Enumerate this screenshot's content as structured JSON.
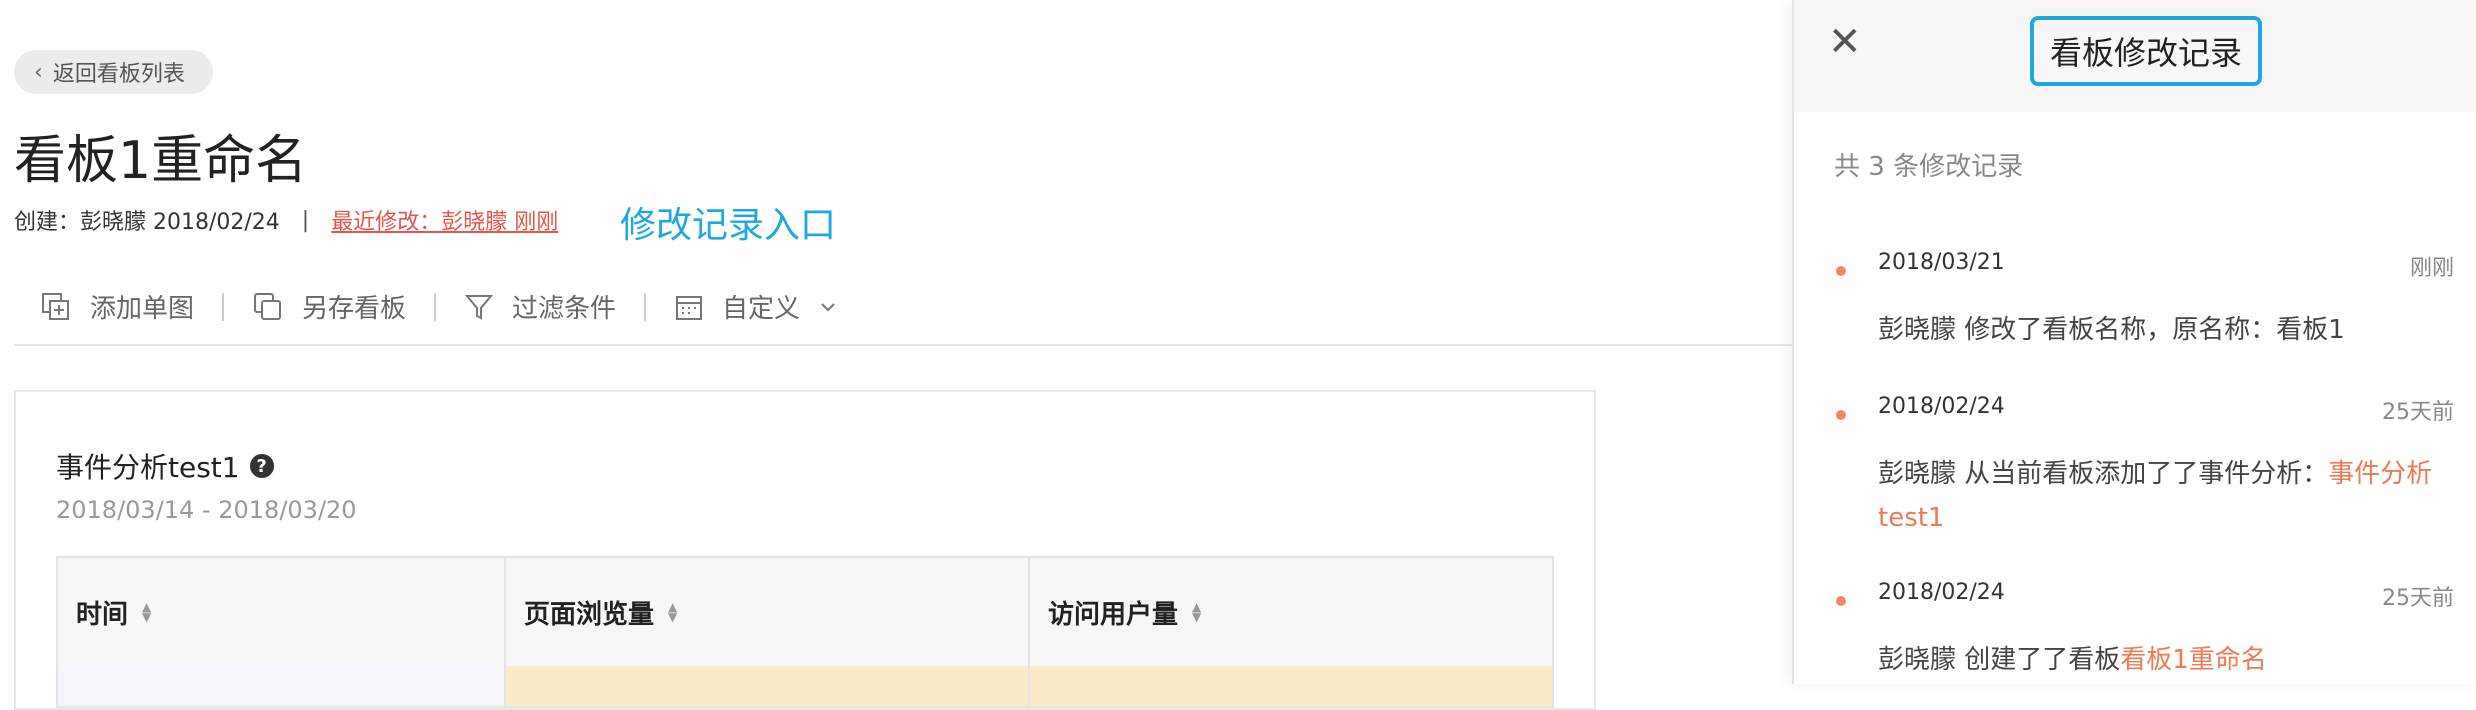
{
  "back_button": "返回看板列表",
  "board_title": "看板1重命名",
  "meta": {
    "created": "创建：彭晓朦 2018/02/24",
    "separator": "|",
    "last_modified": "最近修改：彭晓朦 刚刚"
  },
  "annotation": "修改记录入口",
  "toolbar": {
    "add_chart": "添加单图",
    "save_as": "另存看板",
    "filter": "过滤条件",
    "custom": "自定义"
  },
  "card": {
    "title": "事件分析test1",
    "help_icon": "?",
    "date_range": "2018/03/14 - 2018/03/20",
    "columns": [
      "时间",
      "页面浏览量",
      "访问用户量"
    ]
  },
  "panel": {
    "close": "✕",
    "title": "看板修改记录",
    "count": "共 3 条修改记录",
    "records": [
      {
        "date": "2018/03/21",
        "relative": "刚刚",
        "text": "彭晓朦 修改了看板名称，原名称：看板1",
        "highlight": ""
      },
      {
        "date": "2018/02/24",
        "relative": "25天前",
        "text": "彭晓朦 从当前看板添加了了事件分析：",
        "highlight": "事件分析test1"
      },
      {
        "date": "2018/02/24",
        "relative": "25天前",
        "text": "彭晓朦 创建了了看板",
        "highlight": "看板1重命名"
      }
    ]
  },
  "colors": {
    "accent_blue": "#1fa8e0",
    "link_red": "#e5534b",
    "highlight_orange": "#ee7a55",
    "table_highlight": "#fdebc8"
  }
}
